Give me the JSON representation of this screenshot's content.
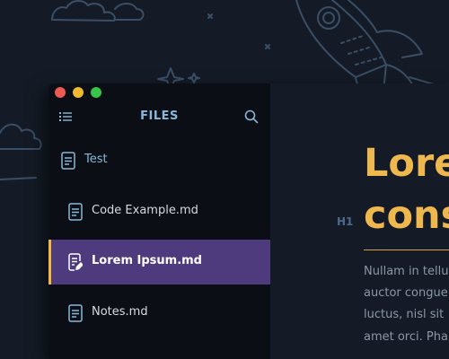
{
  "window": {
    "controls": [
      "close",
      "minimize",
      "maximize"
    ]
  },
  "sidebar": {
    "title": "FILES",
    "items": [
      {
        "label": "Test",
        "type": "folder"
      },
      {
        "label": "Code Example.md",
        "type": "file"
      },
      {
        "label": "Lorem Ipsum.md",
        "type": "file",
        "active": true
      },
      {
        "label": "Notes.md",
        "type": "file"
      }
    ]
  },
  "editor": {
    "heading_marker": "H1",
    "heading_lines": [
      "Lore",
      "cons"
    ],
    "paragraph_lines": [
      "Nullam in tellu",
      "auctor congue",
      "luctus, nisl sit",
      "amet orci. Pha"
    ]
  },
  "colors": {
    "accent": "#f1b93f",
    "active_row": "#4d3b7e",
    "heading": "#efb84e"
  }
}
